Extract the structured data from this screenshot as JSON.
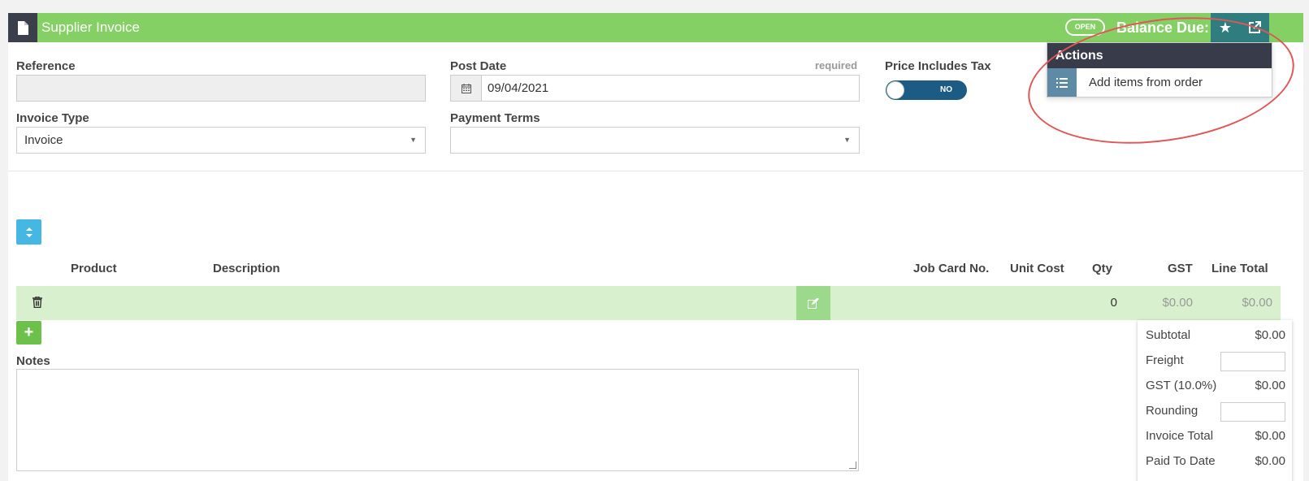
{
  "header": {
    "title": "Supplier Invoice",
    "status": "OPEN",
    "balance": "Balance Due: $0.00",
    "accent_color": "#84d064",
    "dark_color": "#3a3f4b",
    "icons": [
      "document-icon",
      "star-icon",
      "external-link-icon"
    ]
  },
  "form": {
    "reference_label": "Reference",
    "reference_value": "",
    "post_date_label": "Post Date",
    "post_date_required": "required",
    "post_date_value": "09/04/2021",
    "price_tax_label": "Price Includes Tax",
    "price_tax_toggle": "NO",
    "invoice_type_label": "Invoice Type",
    "invoice_type_value": "Invoice",
    "payment_terms_label": "Payment Terms",
    "payment_terms_value": ""
  },
  "actions_menu": {
    "title": "Actions",
    "items": [
      {
        "label": "Add items from order",
        "icon": "list-icon"
      }
    ]
  },
  "table": {
    "columns": [
      "Product",
      "Description",
      "Job Card No.",
      "Unit Cost",
      "Qty",
      "GST",
      "Line Total"
    ],
    "rows": [
      {
        "product": "",
        "description": "",
        "job_card": "",
        "unit_cost": "",
        "qty": "0",
        "gst": "$0.00",
        "line_total": "$0.00"
      }
    ]
  },
  "notes": {
    "label": "Notes",
    "value": ""
  },
  "totals": {
    "subtotal_label": "Subtotal",
    "subtotal": "$0.00",
    "freight_label": "Freight",
    "freight": "",
    "gst_label": "GST (10.0%)",
    "gst": "$0.00",
    "rounding_label": "Rounding",
    "rounding": "",
    "invoice_total_label": "Invoice Total",
    "invoice_total": "$0.00",
    "paid_label": "Paid To Date",
    "paid": "$0.00"
  }
}
